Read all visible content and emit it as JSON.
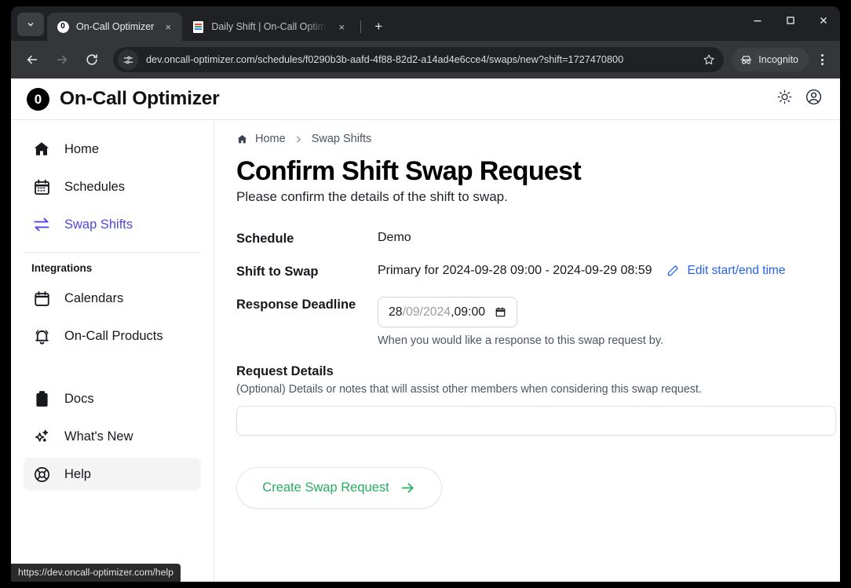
{
  "browser": {
    "tabs": [
      {
        "title": "On-Call Optimizer",
        "favicon": "oncall-logo-favicon",
        "active": true
      },
      {
        "title": "Daily Shift | On-Call Optim",
        "favicon": "spreadsheet-favicon",
        "active": false
      }
    ],
    "new_tab_label": "+",
    "close_label": "×",
    "url": "dev.oncall-optimizer.com/schedules/f0290b3b-aafd-4f88-82d2-a14ad4e6cce4/swaps/new?shift=1727470800",
    "incognito_label": "Incognito",
    "window_controls": {
      "minimize": "–",
      "maximize": "□",
      "close": "✕"
    }
  },
  "app": {
    "logo_text": "0",
    "name": "On-Call Optimizer"
  },
  "sidebar": {
    "primary_items": [
      {
        "label": "Home",
        "icon": "home-icon",
        "state": "default"
      },
      {
        "label": "Schedules",
        "icon": "calendar-days-icon",
        "state": "default"
      },
      {
        "label": "Swap Shifts",
        "icon": "swap-arrows-icon",
        "state": "active"
      }
    ],
    "section_title": "Integrations",
    "integration_items": [
      {
        "label": "Calendars",
        "icon": "calendar-icon",
        "state": "default"
      },
      {
        "label": "On-Call Products",
        "icon": "bell-icon",
        "state": "default"
      }
    ],
    "footer_items": [
      {
        "label": "Docs",
        "icon": "clipboard-icon",
        "state": "default"
      },
      {
        "label": "What's New",
        "icon": "sparkles-icon",
        "state": "default"
      },
      {
        "label": "Help",
        "icon": "lifebuoy-icon",
        "state": "hovered"
      }
    ]
  },
  "breadcrumb": {
    "home": "Home",
    "current": "Swap Shifts",
    "separator": "›"
  },
  "page": {
    "title": "Confirm Shift Swap Request",
    "subtitle": "Please confirm the details of the shift to swap."
  },
  "form": {
    "schedule": {
      "label": "Schedule",
      "value": "Demo"
    },
    "shift": {
      "label": "Shift to Swap",
      "value": "Primary for 2024-09-28 09:00 - 2024-09-29 08:59",
      "edit_link": "Edit start/end time"
    },
    "deadline": {
      "label": "Response Deadline",
      "day": "28",
      "slash1": "/",
      "month": "09",
      "slash2": "/",
      "year": "2024",
      "comma": ", ",
      "time": "09:00",
      "hint": "When you would like a response to this swap request by."
    },
    "details": {
      "title": "Request Details",
      "hint": "(Optional) Details or notes that will assist other members when considering this swap request.",
      "value": "",
      "placeholder": ""
    },
    "submit_label": "Create Swap Request"
  },
  "status_bar": {
    "url": "https://dev.oncall-optimizer.com/help"
  },
  "colors": {
    "accent": "#4f46e5",
    "link": "#2563eb",
    "success": "#27ae60",
    "chrome_dark": "#202124"
  }
}
